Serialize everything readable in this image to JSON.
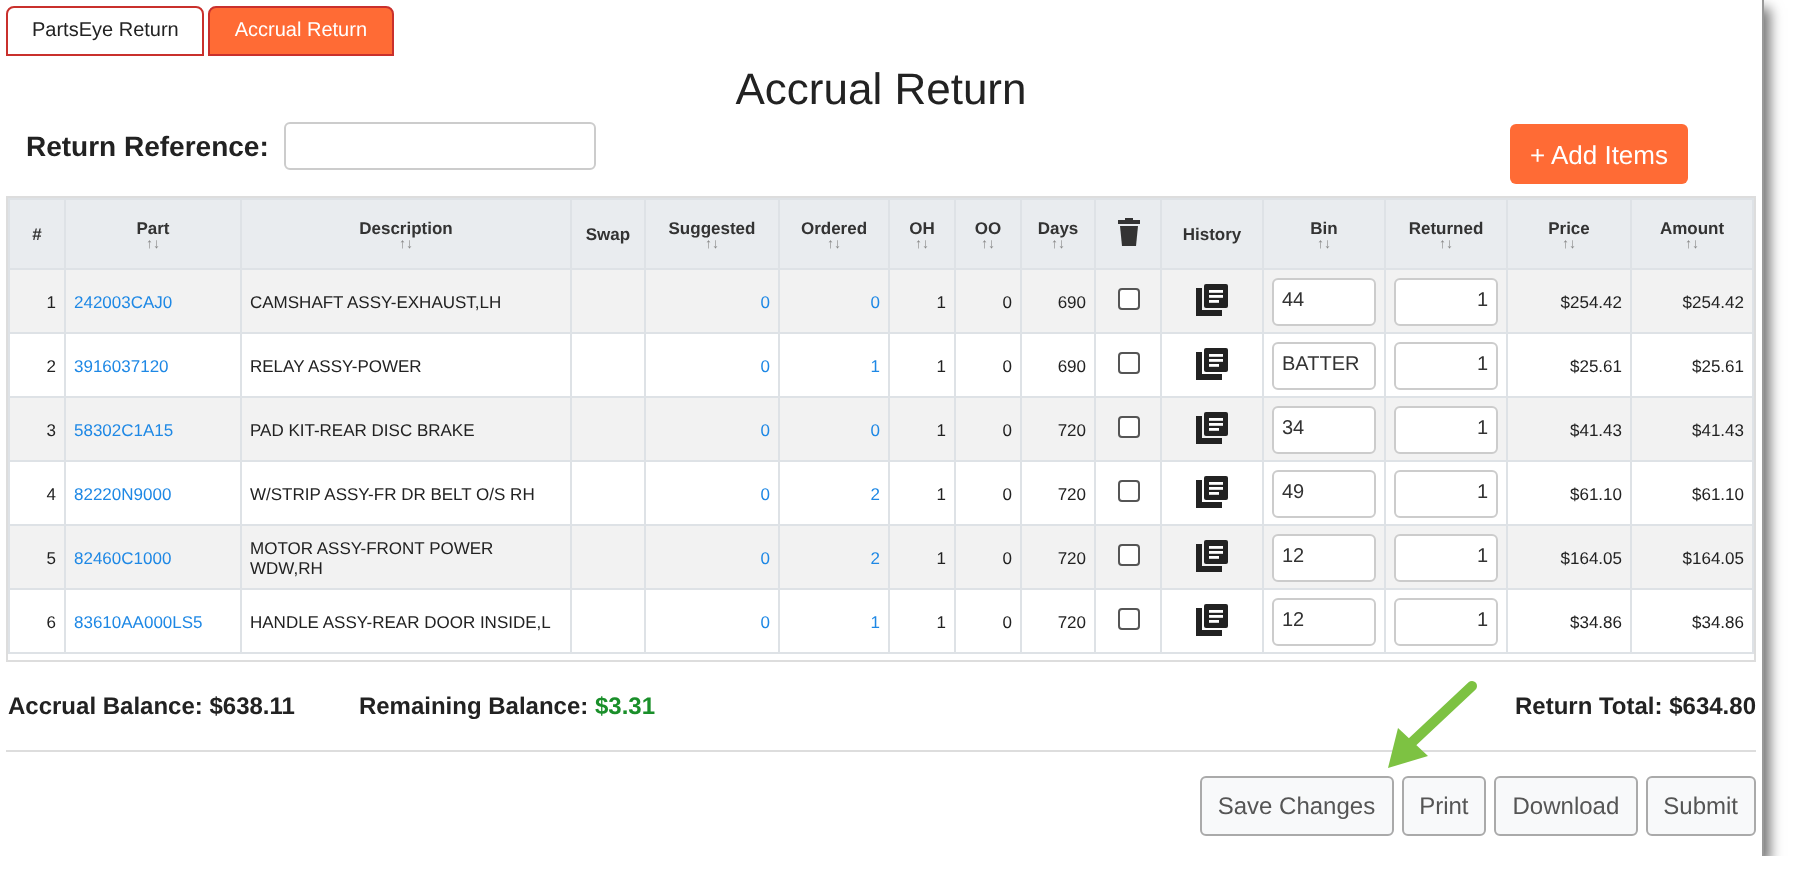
{
  "tabs": [
    {
      "label": "PartsEye Return",
      "selected": false
    },
    {
      "label": "Accrual Return",
      "selected": true
    }
  ],
  "title": "Accrual Return",
  "return_reference": {
    "label": "Return Reference:"
  },
  "add_button": "+ Add Items",
  "table": {
    "columns": [
      {
        "kind": "text",
        "label": "#"
      },
      {
        "kind": "text",
        "label": "Part",
        "sort": "↑↓"
      },
      {
        "kind": "text",
        "label": "Description",
        "sort": "↑↓"
      },
      {
        "kind": "text",
        "label": "Swap"
      },
      {
        "kind": "text",
        "label": "Suggested",
        "sort": "↑↓"
      },
      {
        "kind": "text",
        "label": "Ordered",
        "sort": "↑↓"
      },
      {
        "kind": "text",
        "label": "OH",
        "sort": "↑↓"
      },
      {
        "kind": "text",
        "label": "OO",
        "sort": "↑↓"
      },
      {
        "kind": "text",
        "label": "Days",
        "sort": "↑↓"
      },
      {
        "kind": "trash"
      },
      {
        "kind": "text",
        "label": "History"
      },
      {
        "kind": "text",
        "label": "Bin",
        "sort": "↑↓"
      },
      {
        "kind": "text",
        "label": "Returned",
        "sort": "↑↓"
      },
      {
        "kind": "text",
        "label": "Price",
        "sort": "↑↓"
      },
      {
        "kind": "text",
        "label": "Amount",
        "sort": "↑↓"
      }
    ],
    "rows": [
      {
        "num": "1",
        "part": "242003CAJ0",
        "description": "CAMSHAFT ASSY-EXHAUST,LH",
        "suggested": "0",
        "ordered": "0",
        "oh": "1",
        "oo": "0",
        "days": "690",
        "checked": false,
        "bin": "44",
        "returned": "1",
        "price": "$254.42",
        "amount": "$254.42"
      },
      {
        "num": "2",
        "part": "3916037120",
        "description": "RELAY ASSY-POWER",
        "suggested": "0",
        "ordered": "1",
        "oh": "1",
        "oo": "0",
        "days": "690",
        "checked": false,
        "bin": "BATTER",
        "returned": "1",
        "price": "$25.61",
        "amount": "$25.61"
      },
      {
        "num": "3",
        "part": "58302C1A15",
        "description": "PAD KIT-REAR DISC BRAKE",
        "suggested": "0",
        "ordered": "0",
        "oh": "1",
        "oo": "0",
        "days": "720",
        "checked": false,
        "bin": "34",
        "returned": "1",
        "price": "$41.43",
        "amount": "$41.43"
      },
      {
        "num": "4",
        "part": "82220N9000",
        "description": "W/STRIP ASSY-FR DR BELT O/S RH",
        "suggested": "0",
        "ordered": "2",
        "oh": "1",
        "oo": "0",
        "days": "720",
        "checked": false,
        "bin": "49",
        "returned": "1",
        "price": "$61.10",
        "amount": "$61.10"
      },
      {
        "num": "5",
        "part": "82460C1000",
        "description": "MOTOR ASSY-FRONT POWER WDW,RH",
        "suggested": "0",
        "ordered": "2",
        "oh": "1",
        "oo": "0",
        "days": "720",
        "checked": false,
        "bin": "12",
        "returned": "1",
        "price": "$164.05",
        "amount": "$164.05"
      },
      {
        "num": "6",
        "part": "83610AA000LS5",
        "description": "HANDLE ASSY-REAR DOOR INSIDE,L",
        "suggested": "0",
        "ordered": "1",
        "oh": "1",
        "oo": "0",
        "days": "720",
        "checked": false,
        "bin": "12",
        "returned": "1",
        "price": "$34.86",
        "amount": "$34.86"
      }
    ]
  },
  "summary": {
    "accrual_label": "Accrual Balance:",
    "accrual_value": "$638.11",
    "remaining_label": "Remaining Balance:",
    "remaining_value": "$3.31",
    "total_label": "Return Total:",
    "total_value": "$634.80"
  },
  "buttons": [
    "Save Changes",
    "Print",
    "Download",
    "Submit"
  ]
}
